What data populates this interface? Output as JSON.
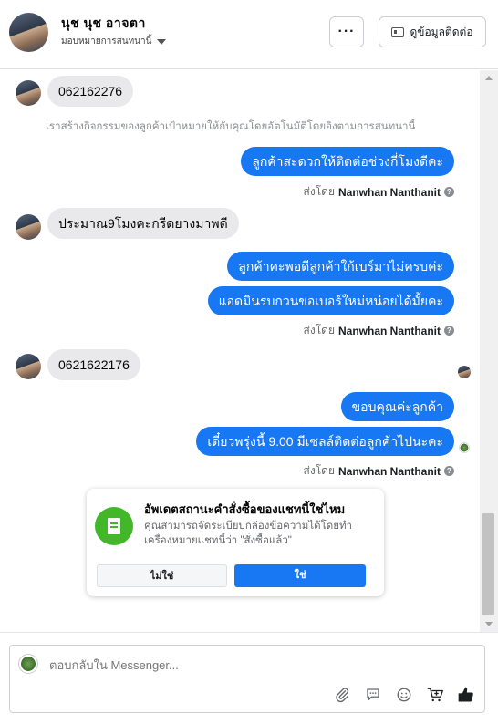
{
  "header": {
    "name": "นุช นุช อาจตา",
    "assign_label": "มอบหมายการสนทนานี้",
    "more_label": "···",
    "contact_label": "ดูข้อมูลติดต่อ"
  },
  "messages": {
    "m1": "062162276",
    "system_note": "เราสร้างกิจกรรมของลูกค้าเป้าหมายให้กับคุณโดยอัตโนมัติโดยอิงตามการสนทนานี้",
    "m2": "ลูกค้าสะดวกให้ติดต่อช่วงกี่โมงดีคะ",
    "m3": "ประมาณ9โมงคะกรีดยางมาพดี",
    "m4": "ลูกค้าคะพอดีลูกค้าใก้เบร์มาไม่ครบค่ะ",
    "m5": "แอดมินรบกวนขอเบอร์ใหม่หน่อยได้มั้ยคะ",
    "m6": "0621622176",
    "m7": "ขอบคุณค่ะลูกค้า",
    "m8": "เดี๋ยวพรุ่งนี้ 9.00 มีเซลล์ติดต่อลูกค้าไปนะคะ"
  },
  "sent_by": {
    "prefix": "ส่งโดย",
    "agent": "Nanwhan Nanthanit",
    "help": "?"
  },
  "prompt": {
    "title": "อัพเดตสถานะคำสั่งซื้อของแชทนี้ใช่ไหม",
    "body": "คุณสามารถจัดระเบียบกล่องข้อความได้โดยทำเครื่องหมายแชทนี้ว่า \"สั่งซื้อแล้ว\"",
    "no_label": "ไม่ใช่",
    "yes_label": "ใช่"
  },
  "composer": {
    "placeholder": "ตอบกลับใน Messenger..."
  },
  "icons": {
    "attach": "paperclip-icon",
    "saved_replies": "chat-bubbles-icon",
    "emoji": "smiley-icon",
    "cart": "add-to-cart-icon",
    "like": "thumbs-up-icon"
  },
  "colors": {
    "accent": "#1877f2",
    "incoming_bubble": "#e9e9eb",
    "prompt_icon": "#42b72a"
  }
}
